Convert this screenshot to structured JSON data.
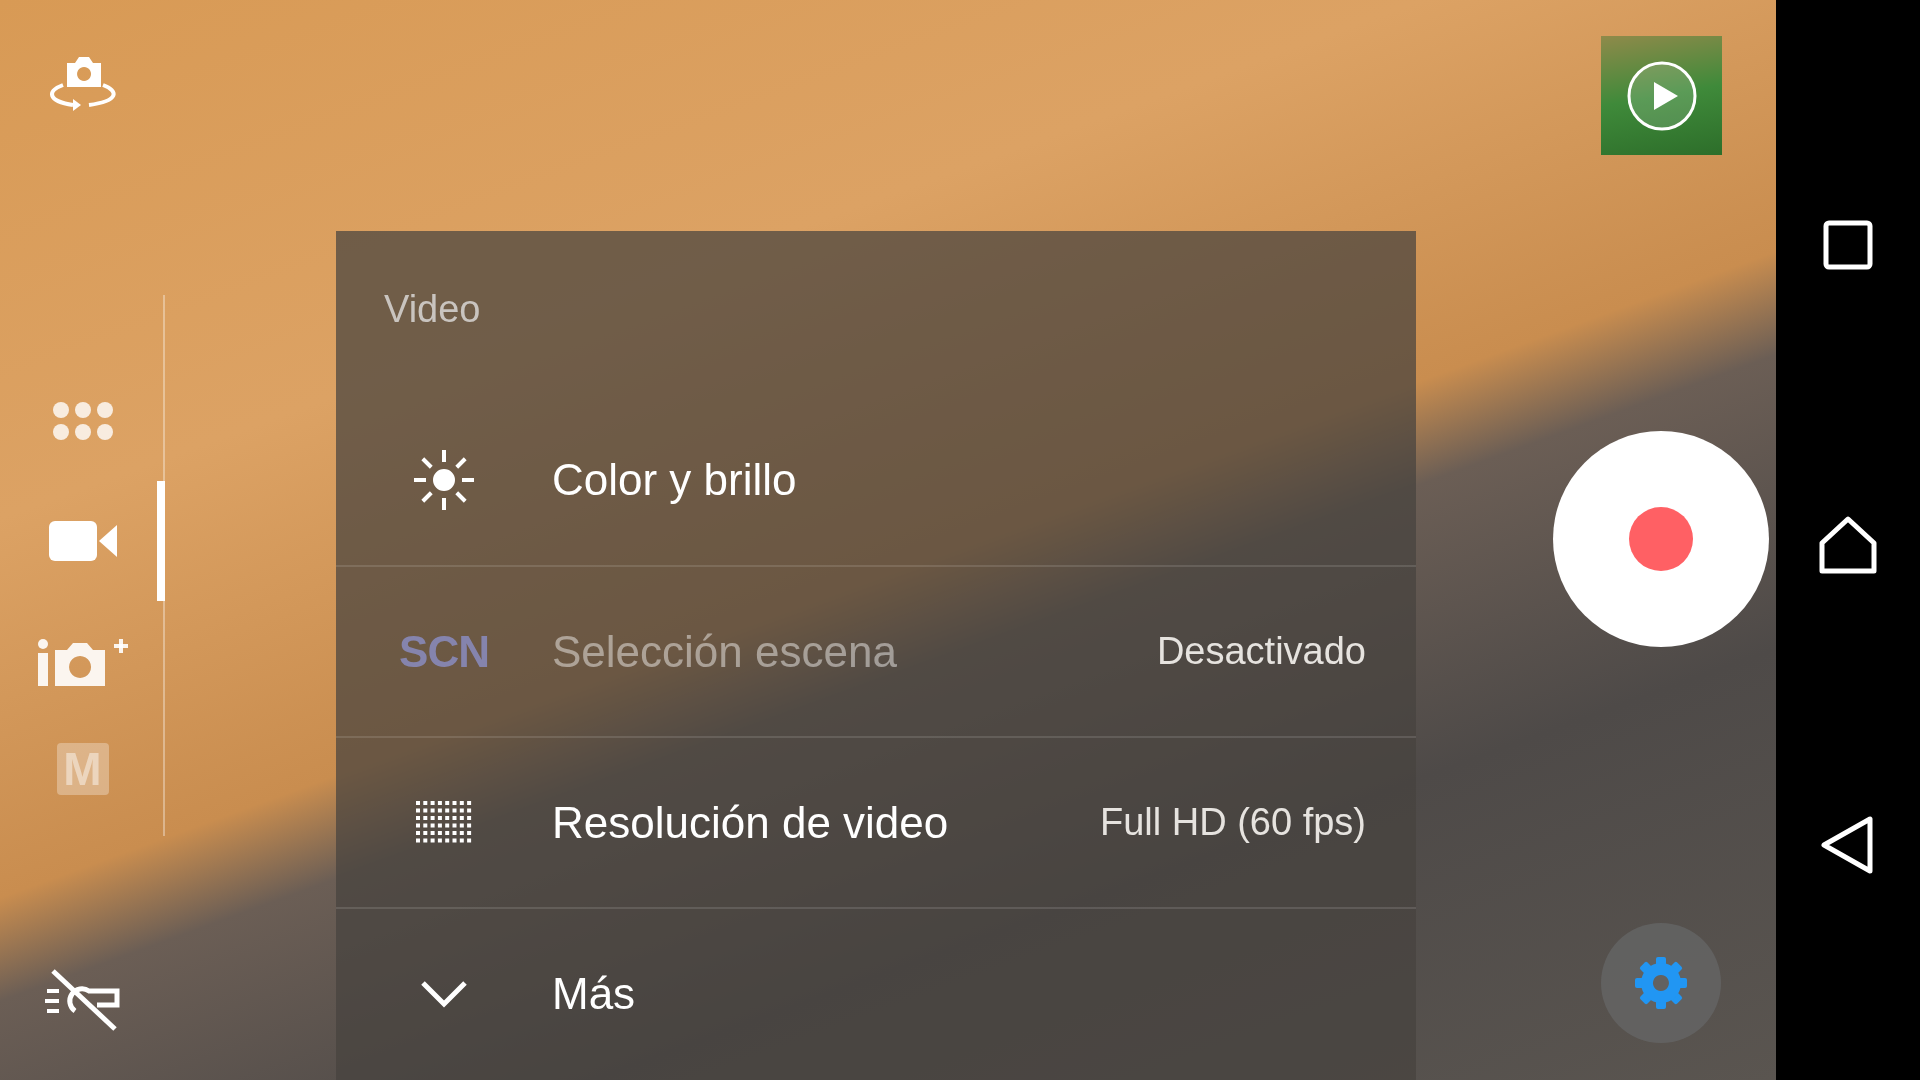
{
  "mode_rail": {
    "modes": [
      {
        "kind": "grid",
        "selected": false
      },
      {
        "kind": "video",
        "selected": true
      },
      {
        "kind": "photo_plus",
        "selected": false
      },
      {
        "kind": "manual",
        "label": "M",
        "selected": false
      }
    ]
  },
  "menu": {
    "title": "Video",
    "items": [
      {
        "kind": "sun",
        "label": "Color y brillo",
        "disabled": false
      },
      {
        "kind": "badge",
        "icon_text": "SCN",
        "label": "Selección escena",
        "value": "Desactivado",
        "disabled": true
      },
      {
        "kind": "grid",
        "label": "Resolución de video",
        "value": "Full HD (60 fps)",
        "disabled": false
      },
      {
        "kind": "chevron",
        "label": "Más",
        "disabled": false
      }
    ]
  }
}
